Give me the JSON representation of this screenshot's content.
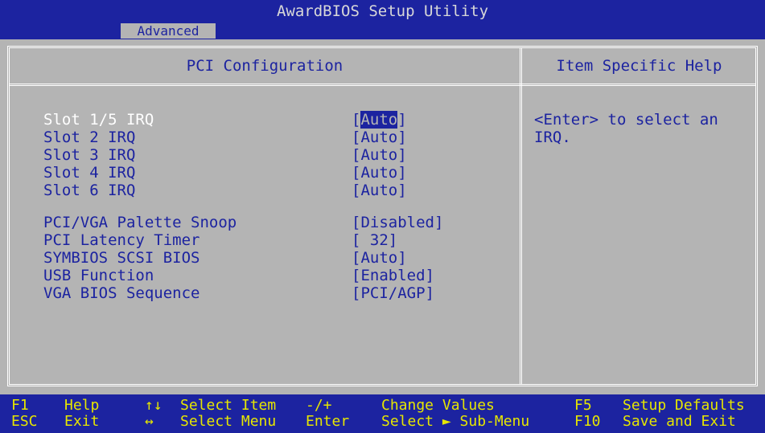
{
  "title": "AwardBIOS Setup Utility",
  "menu": {
    "active_tab": "Advanced"
  },
  "main": {
    "title": "PCI Configuration",
    "items": [
      {
        "label": "Slot 1/5 IRQ",
        "value_left": "[",
        "value_highlight": "Auto",
        "value_right": "]"
      },
      {
        "label": "Slot  2  IRQ",
        "value": "[Auto]"
      },
      {
        "label": "Slot  3  IRQ",
        "value": "[Auto]"
      },
      {
        "label": "Slot  4  IRQ",
        "value": "[Auto]"
      },
      {
        "label": "Slot  6  IRQ",
        "value": "[Auto]"
      },
      {
        "label": "PCI/VGA Palette Snoop",
        "value": "[Disabled]"
      },
      {
        "label": "PCI Latency Timer",
        "value": "[ 32]"
      },
      {
        "label": "SYMBIOS SCSI BIOS",
        "value": "[Auto]"
      },
      {
        "label": "USB Function",
        "value": "[Enabled]"
      },
      {
        "label": "VGA BIOS Sequence",
        "value": "[PCI/AGP]"
      }
    ]
  },
  "help": {
    "title": "Item Specific Help",
    "text": "<Enter> to select an\nIRQ."
  },
  "footer": {
    "row1": [
      {
        "key": "F1",
        "desc": "Help"
      },
      {
        "key": "↑↓",
        "desc": "Select Item"
      },
      {
        "key": "-/+",
        "desc": "Change Values"
      },
      {
        "key": "F5",
        "desc": "Setup Defaults"
      }
    ],
    "row2": [
      {
        "key": "ESC",
        "desc": "Exit"
      },
      {
        "key": "↔",
        "desc": "Select Menu"
      },
      {
        "key": "Enter",
        "desc": "Select ► Sub-Menu"
      },
      {
        "key": "F10",
        "desc": "Save and Exit"
      }
    ]
  },
  "colors": {
    "background": "#b4b4b4",
    "accent": "#1c23a0",
    "footer_text": "#e6e600"
  }
}
